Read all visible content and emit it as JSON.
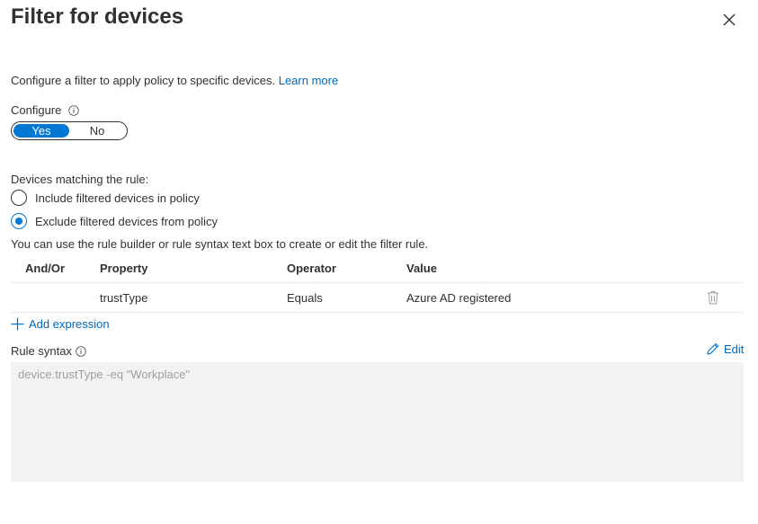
{
  "panel": {
    "title": "Filter for devices",
    "close_icon": "close-icon"
  },
  "intro": {
    "text": "Configure a filter to apply policy to specific devices.",
    "link_text": "Learn more"
  },
  "configure": {
    "label": "Configure",
    "options": [
      "Yes",
      "No"
    ],
    "selected": "Yes"
  },
  "matching": {
    "label": "Devices matching the rule:",
    "options": [
      {
        "label": "Include filtered devices in policy",
        "checked": false
      },
      {
        "label": "Exclude filtered devices from policy",
        "checked": true
      }
    ]
  },
  "helper_text": "You can use the rule builder or rule syntax text box to create or edit the filter rule.",
  "table": {
    "headers": [
      "And/Or",
      "Property",
      "Operator",
      "Value"
    ],
    "rows": [
      {
        "andor": "",
        "property": "trustType",
        "operator": "Equals",
        "value": "Azure AD registered"
      }
    ]
  },
  "add_expression_label": "Add expression",
  "rule_syntax": {
    "label": "Rule syntax",
    "edit_label": "Edit",
    "value": "device.trustType -eq \"Workplace\""
  },
  "colors": {
    "accent": "#0078d4",
    "link": "#0067b8",
    "text": "#323130",
    "disabled_text": "#a19f9d",
    "textbox_bg": "#f3f2f1"
  }
}
